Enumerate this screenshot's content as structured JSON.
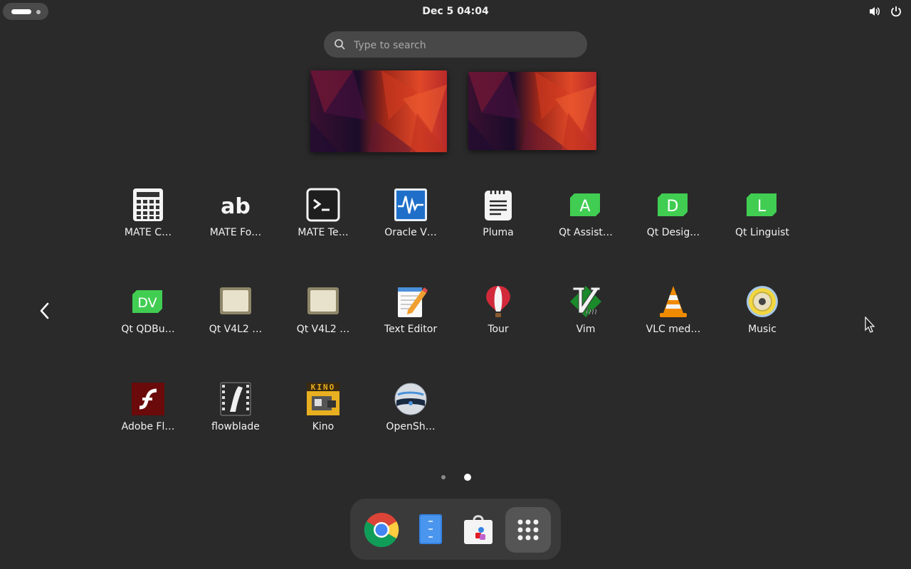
{
  "topbar": {
    "clock": "Dec 5  04:04",
    "icons": [
      "activities-indicator",
      "volume-icon",
      "power-icon"
    ]
  },
  "search": {
    "placeholder": "Type to search"
  },
  "apps": [
    {
      "label": "MATE C…",
      "icon": "calculator-icon"
    },
    {
      "label": "MATE Fo…",
      "icon": "font-viewer-icon"
    },
    {
      "label": "MATE Te…",
      "icon": "terminal-icon"
    },
    {
      "label": "Oracle V…",
      "icon": "virtualbox-icon"
    },
    {
      "label": "Pluma",
      "icon": "pluma-icon"
    },
    {
      "label": "Qt Assist…",
      "icon": "qt-assistant-icon"
    },
    {
      "label": "Qt Desig…",
      "icon": "qt-designer-icon"
    },
    {
      "label": "Qt Linguist",
      "icon": "qt-linguist-icon"
    },
    {
      "label": "Qt QDBu…",
      "icon": "qt-qdbus-icon"
    },
    {
      "label": "Qt V4L2 …",
      "icon": "qt-v4l2-icon"
    },
    {
      "label": "Qt V4L2 …",
      "icon": "qt-v4l2-icon"
    },
    {
      "label": "Text Editor",
      "icon": "text-editor-icon"
    },
    {
      "label": "Tour",
      "icon": "tour-balloon-icon"
    },
    {
      "label": "Vim",
      "icon": "vim-icon"
    },
    {
      "label": "VLC med…",
      "icon": "vlc-cone-icon"
    },
    {
      "label": "Music",
      "icon": "music-speaker-icon"
    },
    {
      "label": "Adobe Fl…",
      "icon": "flash-icon"
    },
    {
      "label": "flowblade",
      "icon": "flowblade-icon"
    },
    {
      "label": "Kino",
      "icon": "kino-icon"
    },
    {
      "label": "OpenSh…",
      "icon": "openshot-icon"
    }
  ],
  "icon_text": {
    "qt_assistant": "A",
    "qt_designer": "D",
    "qt_linguist": "L",
    "qt_qdbus": "DV",
    "font_viewer": "ab",
    "kino": "KINO"
  },
  "pager": {
    "pages": 2,
    "current": 2
  },
  "dock": [
    "google-chrome-icon",
    "files-icon",
    "software-store-icon",
    "show-apps-icon"
  ],
  "colors": {
    "background": "#2a2a2a",
    "qt_green": "#41cd52",
    "accent_blue": "#3584e4"
  }
}
